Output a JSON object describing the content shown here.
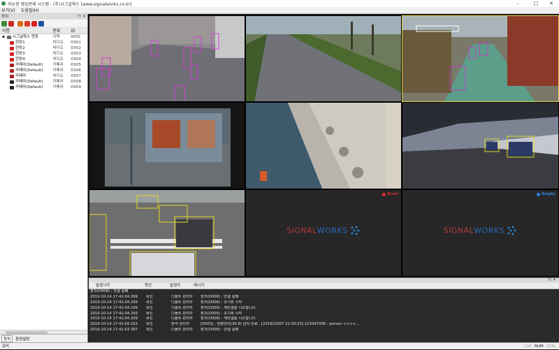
{
  "window": {
    "title": "지능형 영상관제 시스템 - (주)시그널웍스 [www.signalworks.co.kr]",
    "minimize": "–",
    "maximize": "□",
    "close": "✕"
  },
  "menu": [
    "보기(V)",
    "도움말(H)"
  ],
  "device_panel": {
    "title": "장치",
    "pin": "⊓ ✕",
    "toolbar_colors": [
      "#3a8a3a",
      "#c82828",
      "#d86a10",
      "#d83a2a",
      "#d82020",
      "#1f4fa0"
    ],
    "columns": {
      "name": "이름",
      "kind": "종류",
      "id": "ID"
    },
    "items": [
      {
        "name": "시그널웍스 현장",
        "kind": "지역",
        "id": "A001",
        "icon_color": "#666666"
      },
      {
        "name": "현장1",
        "kind": "비디오",
        "id": "D001",
        "icon_color": "#d32020"
      },
      {
        "name": "현장2",
        "kind": "비디오",
        "id": "D002",
        "icon_color": "#d32020"
      },
      {
        "name": "현장3",
        "kind": "비디오",
        "id": "D003",
        "icon_color": "#d32020"
      },
      {
        "name": "현장4",
        "kind": "비디오",
        "id": "D004",
        "icon_color": "#d32020"
      },
      {
        "name": "카메라(Default)",
        "kind": "카메라",
        "id": "D005",
        "icon_color": "#b02020"
      },
      {
        "name": "카메라(Default)",
        "kind": "카메라",
        "id": "D006",
        "icon_color": "#b02020"
      },
      {
        "name": "카메라",
        "kind": "비디오",
        "id": "D007",
        "icon_color": "#b02020"
      },
      {
        "name": "카메라(Default)",
        "kind": "카메라",
        "id": "D008",
        "icon_color": "#222222"
      },
      {
        "name": "카메라(Default)",
        "kind": "카메라",
        "id": "D009",
        "icon_color": "#222222"
      }
    ],
    "tabs": [
      "장치",
      "환경설정"
    ]
  },
  "video_grid": {
    "cells": [
      {
        "name": "camera-1-street",
        "selected": false
      },
      {
        "name": "camera-2-path",
        "selected": false
      },
      {
        "name": "camera-3-sidewalk",
        "selected": true
      },
      {
        "name": "camera-4-storefront",
        "selected": false
      },
      {
        "name": "camera-5-seawall",
        "selected": false
      },
      {
        "name": "camera-6-highway",
        "selected": false
      },
      {
        "name": "camera-7-intersection",
        "selected": false
      }
    ],
    "logo_cells": [
      {
        "badge": "Error",
        "badge_color": "#e43030",
        "logo_signal": "SIGNAL",
        "logo_works": "WORKS"
      },
      {
        "badge": "Empty",
        "badge_color": "#2a8ae0",
        "logo_signal": "SIGNAL",
        "logo_works": "WORKS"
      }
    ]
  },
  "events": {
    "topbar_ctrl": "⊓ ✕",
    "columns": [
      "발생시각",
      "확인",
      "발생자",
      "메시지"
    ],
    "first_row": "장치(D008) : 연결 실패",
    "rows": [
      {
        "time": "2019-10-14 17:41:04.299",
        "ack": "확인",
        "source": "디폴트 관리자",
        "message": "장치(D008) : 연결 실패"
      },
      {
        "time": "2019-10-14 17:41:04.299",
        "ack": "확인",
        "source": "디폴트 관리자",
        "message": "장치(D008) : 초기화 시작"
      },
      {
        "time": "2019-10-14 17:41:04.299",
        "ack": "확인",
        "source": "디폴트 관리자",
        "message": "장치(D009) : 재연결을 시도합니다."
      },
      {
        "time": "2019-10-14 17:41:04.299",
        "ack": "확인",
        "source": "디폴트 관리자",
        "message": "장치(D009) : 초기화 시작"
      },
      {
        "time": "2019-10-14 17:41:04.299",
        "ack": "확인",
        "source": "디폴트 관리자",
        "message": "장치(D008) : 재연결을 시도합니다."
      },
      {
        "time": "2019-10-14 17:41:04.162",
        "ack": "확인",
        "source": "분석 관리자",
        "message": "[D003] : 방향전이(30.8) 감지 완료 : [2019/10/07 21:50:53] 215047009 : person <<<<..."
      },
      {
        "time": "2019-10-14 17:41:03.397",
        "ack": "확인",
        "source": "디폴트 관리자",
        "message": "장치(D008) : 연결 실패"
      }
    ]
  },
  "status": {
    "text": "준비",
    "indicators": [
      {
        "label": "CAP",
        "on": false
      },
      {
        "label": "NUM",
        "on": true
      },
      {
        "label": "SCRL",
        "on": false
      }
    ]
  }
}
